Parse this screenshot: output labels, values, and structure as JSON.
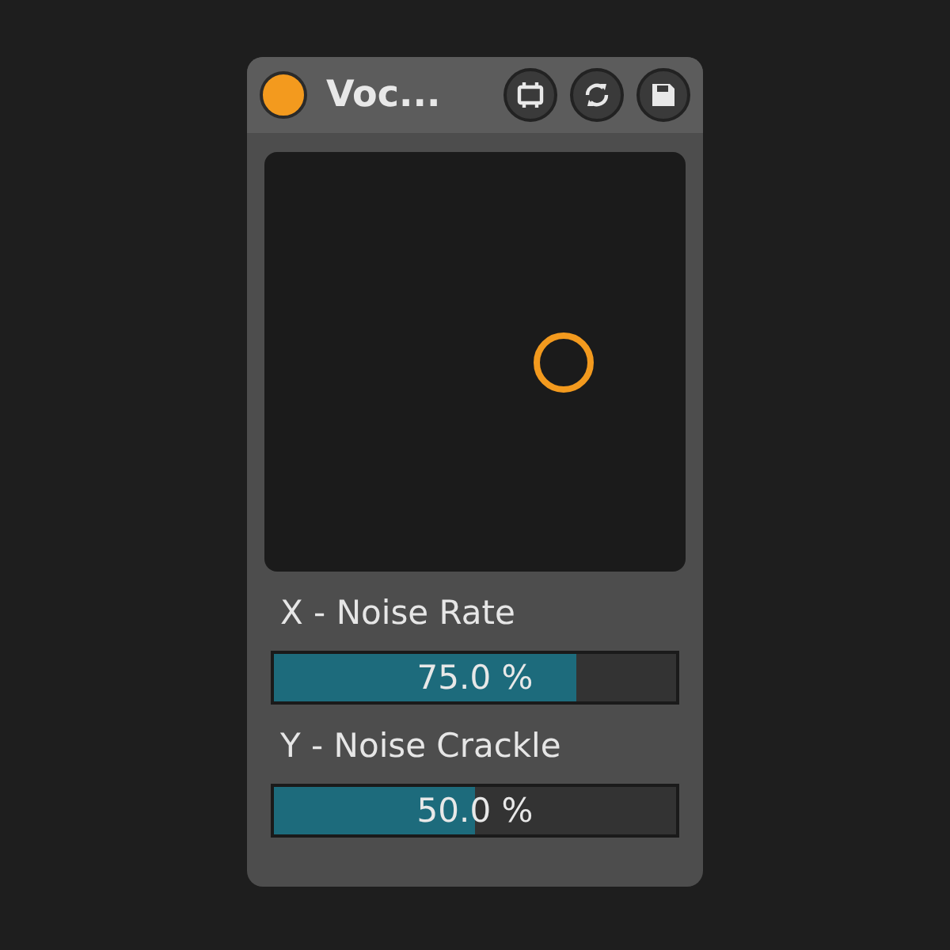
{
  "device": {
    "title": "Voc...",
    "on": true
  },
  "params": [
    {
      "label": "X - Noise Rate",
      "value": "75.0 %",
      "level": 0.75
    },
    {
      "label": "Y - Noise Crackle",
      "value": "50.0 %",
      "level": 0.5
    }
  ]
}
